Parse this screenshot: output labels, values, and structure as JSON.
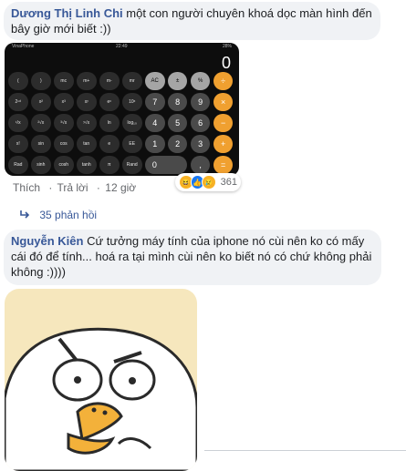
{
  "comment1": {
    "author": "Dương Thị Linh Chi",
    "text": "một con người chuyên khoá dọc màn hình đến bây giờ mới biết :))",
    "calculator": {
      "status_left": "VinaPhone",
      "status_time": "22:49",
      "status_right": "28%",
      "display": "0",
      "keys": [
        {
          "label": "(",
          "kind": "fn"
        },
        {
          "label": ")",
          "kind": "fn"
        },
        {
          "label": "mc",
          "kind": "fn"
        },
        {
          "label": "m+",
          "kind": "fn"
        },
        {
          "label": "m-",
          "kind": "fn"
        },
        {
          "label": "mr",
          "kind": "fn"
        },
        {
          "label": "AC",
          "kind": "gray"
        },
        {
          "label": "±",
          "kind": "gray"
        },
        {
          "label": "%",
          "kind": "gray"
        },
        {
          "label": "÷",
          "kind": "op"
        },
        {
          "label": "2ⁿᵈ",
          "kind": "fn"
        },
        {
          "label": "x²",
          "kind": "fn"
        },
        {
          "label": "x³",
          "kind": "fn"
        },
        {
          "label": "xʸ",
          "kind": "fn"
        },
        {
          "label": "eˣ",
          "kind": "fn"
        },
        {
          "label": "10ˣ",
          "kind": "fn"
        },
        {
          "label": "7",
          "kind": "num"
        },
        {
          "label": "8",
          "kind": "num"
        },
        {
          "label": "9",
          "kind": "num"
        },
        {
          "label": "×",
          "kind": "op"
        },
        {
          "label": "¹/x",
          "kind": "fn"
        },
        {
          "label": "²√x",
          "kind": "fn"
        },
        {
          "label": "³√x",
          "kind": "fn"
        },
        {
          "label": "ʸ√x",
          "kind": "fn"
        },
        {
          "label": "ln",
          "kind": "fn"
        },
        {
          "label": "log₁₀",
          "kind": "fn"
        },
        {
          "label": "4",
          "kind": "num"
        },
        {
          "label": "5",
          "kind": "num"
        },
        {
          "label": "6",
          "kind": "num"
        },
        {
          "label": "−",
          "kind": "op"
        },
        {
          "label": "x!",
          "kind": "fn"
        },
        {
          "label": "sin",
          "kind": "fn"
        },
        {
          "label": "cos",
          "kind": "fn"
        },
        {
          "label": "tan",
          "kind": "fn"
        },
        {
          "label": "e",
          "kind": "fn"
        },
        {
          "label": "EE",
          "kind": "fn"
        },
        {
          "label": "1",
          "kind": "num"
        },
        {
          "label": "2",
          "kind": "num"
        },
        {
          "label": "3",
          "kind": "num"
        },
        {
          "label": "+",
          "kind": "op"
        },
        {
          "label": "Rad",
          "kind": "fn"
        },
        {
          "label": "sinh",
          "kind": "fn"
        },
        {
          "label": "cosh",
          "kind": "fn"
        },
        {
          "label": "tanh",
          "kind": "fn"
        },
        {
          "label": "π",
          "kind": "fn"
        },
        {
          "label": "Rand",
          "kind": "fn"
        },
        {
          "label": "0",
          "kind": "zero"
        },
        {
          "label": ",",
          "kind": "num"
        },
        {
          "label": "=",
          "kind": "op"
        }
      ]
    },
    "actions": {
      "like": "Thích",
      "reply": "Trả lời",
      "time": "12 giờ"
    },
    "reactions": {
      "icons": [
        "haha-icon",
        "like-icon",
        "sad-icon"
      ],
      "count": "361"
    },
    "replies": "35 phản hồi"
  },
  "comment2": {
    "author": "Nguyễn Kiên",
    "text": "Cứ tưởng máy tính của iphone nó cùi nên ko có mấy cái đó để tính... hoá ra tại mình cùi nên ko biết nó có chứ không phải không :))))"
  },
  "colors": {
    "author": "#385898",
    "bubble": "#f0f2f5",
    "calc_op": "#f0a030",
    "sticker_bg": "#f6e7bd"
  }
}
